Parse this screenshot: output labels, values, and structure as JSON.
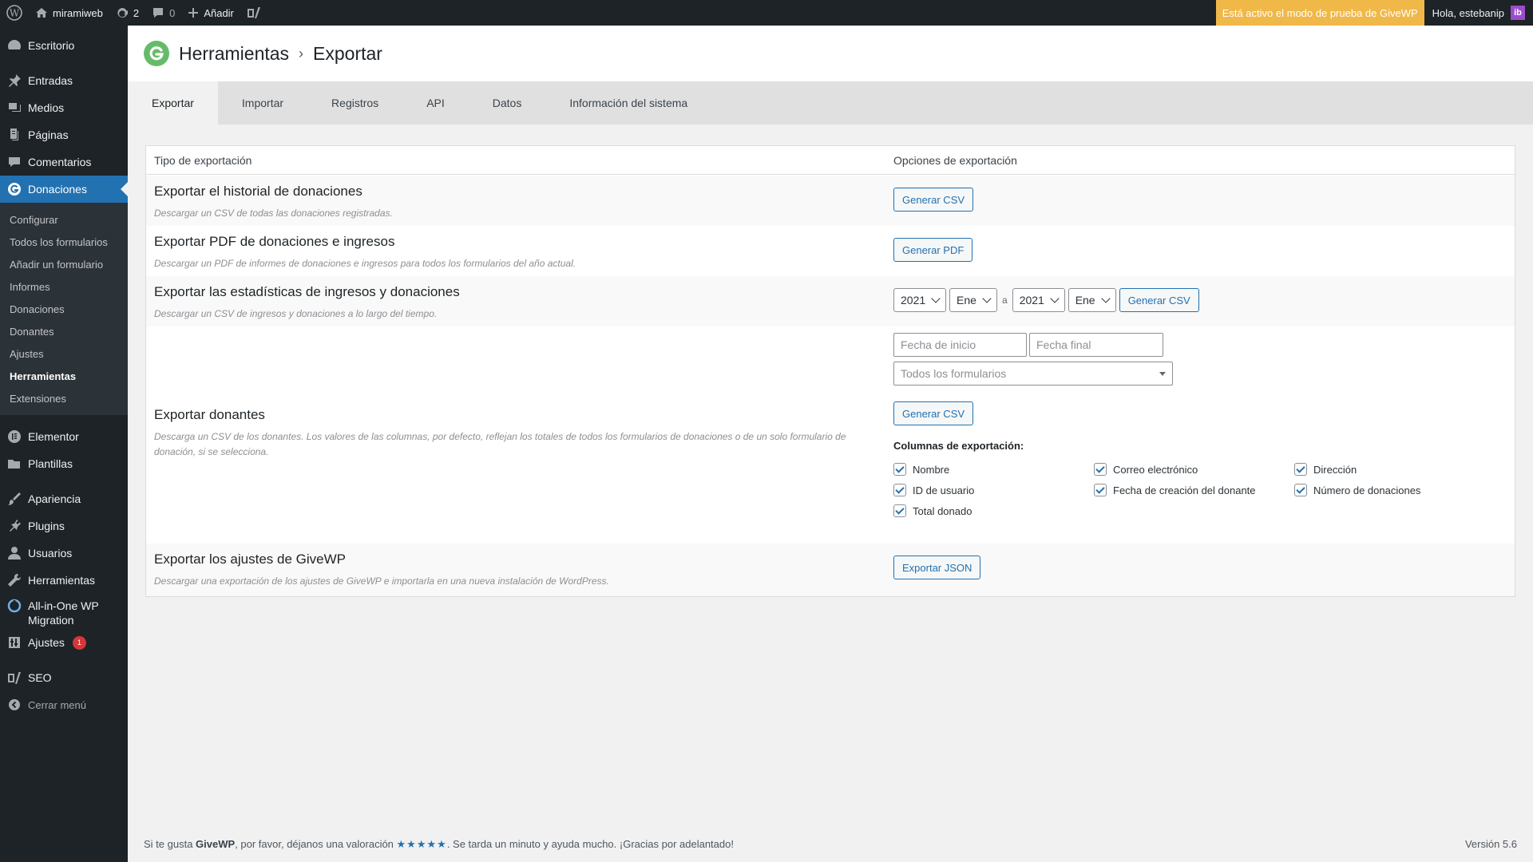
{
  "adminbar": {
    "site_name": "miramiweb",
    "updates_count": "2",
    "comments_count": "0",
    "add_new": "Añadir",
    "test_mode": "Está activo el modo de prueba de GiveWP",
    "howdy": "Hola, estebanip"
  },
  "sidebar": {
    "items": [
      {
        "label": "Escritorio"
      },
      {
        "label": "Entradas"
      },
      {
        "label": "Medios"
      },
      {
        "label": "Páginas"
      },
      {
        "label": "Comentarios"
      },
      {
        "label": "Donaciones"
      },
      {
        "label": "Elementor"
      },
      {
        "label": "Plantillas"
      },
      {
        "label": "Apariencia"
      },
      {
        "label": "Plugins"
      },
      {
        "label": "Usuarios"
      },
      {
        "label": "Herramientas"
      },
      {
        "label": "All-in-One WP Migration"
      },
      {
        "label": "Ajustes",
        "badge": "1"
      },
      {
        "label": "SEO"
      },
      {
        "label": "Cerrar menú"
      }
    ],
    "submenu": [
      {
        "label": "Configurar"
      },
      {
        "label": "Todos los formularios"
      },
      {
        "label": "Añadir un formulario"
      },
      {
        "label": "Informes"
      },
      {
        "label": "Donaciones"
      },
      {
        "label": "Donantes"
      },
      {
        "label": "Ajustes"
      },
      {
        "label": "Herramientas"
      },
      {
        "label": "Extensiones"
      }
    ]
  },
  "header": {
    "title": "Herramientas",
    "separator": "›",
    "subtitle": "Exportar"
  },
  "tabs": [
    {
      "label": "Exportar"
    },
    {
      "label": "Importar"
    },
    {
      "label": "Registros"
    },
    {
      "label": "API"
    },
    {
      "label": "Datos"
    },
    {
      "label": "Información del sistema"
    }
  ],
  "table": {
    "col_type": "Tipo de exportación",
    "col_options": "Opciones de exportación",
    "rows": [
      {
        "title": "Exportar el historial de donaciones",
        "desc": "Descargar un CSV de todas las donaciones registradas.",
        "button": "Generar CSV"
      },
      {
        "title": "Exportar PDF de donaciones e ingresos",
        "desc": "Descargar un PDF de informes de donaciones e ingresos para todos los formularios del año actual.",
        "button": "Generar PDF"
      },
      {
        "title": "Exportar las estadísticas de ingresos y donaciones",
        "desc": "Descargar un CSV de ingresos y donaciones a lo largo del tiempo.",
        "button": "Generar CSV",
        "year_from": "2021",
        "month_from": "Ene",
        "to_label": "a",
        "year_to": "2021",
        "month_to": "Ene"
      },
      {
        "title": "Exportar donantes",
        "desc": "Descarga un CSV de los donantes. Los valores de las columnas, por defecto, reflejan los totales de todos los formularios de donaciones o de un solo formulario de donación, si se selecciona.",
        "button": "Generar CSV",
        "start_placeholder": "Fecha de inicio",
        "end_placeholder": "Fecha final",
        "forms_select": "Todos los formularios",
        "columns_title": "Columnas de exportación:",
        "columns": [
          "Nombre",
          "Correo electrónico",
          "Dirección",
          "ID de usuario",
          "Fecha de creación del donante",
          "Número de donaciones",
          "Total donado"
        ]
      },
      {
        "title": "Exportar los ajustes de GiveWP",
        "desc": "Descargar una exportación de los ajustes de GiveWP e importarla en una nueva instalación de WordPress.",
        "button": "Exportar JSON"
      }
    ]
  },
  "footer": {
    "text_a": "Si te gusta ",
    "brand": "GiveWP",
    "text_b": ", por favor, déjanos una valoración ",
    "stars": "★★★★★",
    "text_c": ". Se tarda un minuto y ayuda mucho. ¡Gracias por adelantado!",
    "version": "Versión 5.6"
  },
  "colors": {
    "accent": "#2271b1",
    "test_mode": "#f0b849",
    "give_green": "#66bb6a"
  }
}
